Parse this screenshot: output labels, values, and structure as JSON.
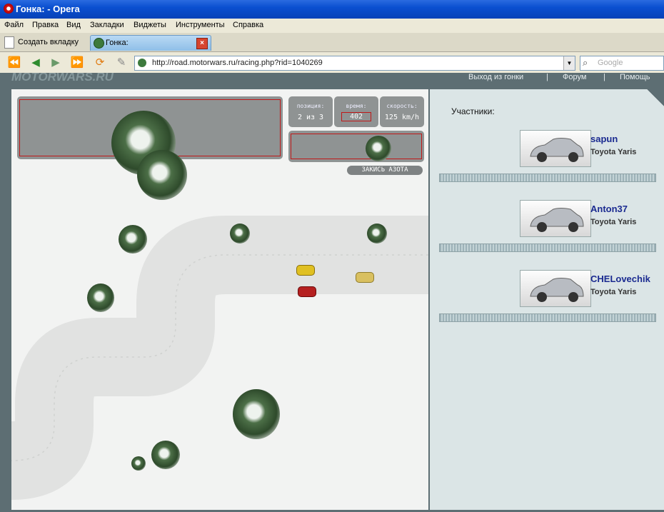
{
  "window": {
    "title": "Гонка: - Opera"
  },
  "menu": [
    "Файл",
    "Правка",
    "Вид",
    "Закладки",
    "Виджеты",
    "Инструменты",
    "Справка"
  ],
  "tabs": {
    "new_tab": "Создать вкладку",
    "active": "Гонка:"
  },
  "address": {
    "url": "http://road.motorwars.ru/racing.php?rid=1040269"
  },
  "search": {
    "placeholder": "Google"
  },
  "site": {
    "brand": "MOTORWARS.RU",
    "nav": [
      "Выход из гонки",
      "|",
      "Форум",
      "|",
      "Помощь"
    ]
  },
  "hud": {
    "position_caption": "позиция:",
    "position_value": "2 из 3",
    "time_caption": "время:",
    "time_value": "402",
    "speed_caption": "скорость:",
    "speed_value": "125 km/h",
    "nitro_label": "ЗАКИСЬ АЗОТА"
  },
  "participants": {
    "title": "Участники:",
    "list": [
      {
        "name": "sapun",
        "car": "Toyota Yaris"
      },
      {
        "name": "Anton37",
        "car": "Toyota Yaris"
      },
      {
        "name": "CHELovechik",
        "car": "Toyota Yaris"
      }
    ]
  }
}
